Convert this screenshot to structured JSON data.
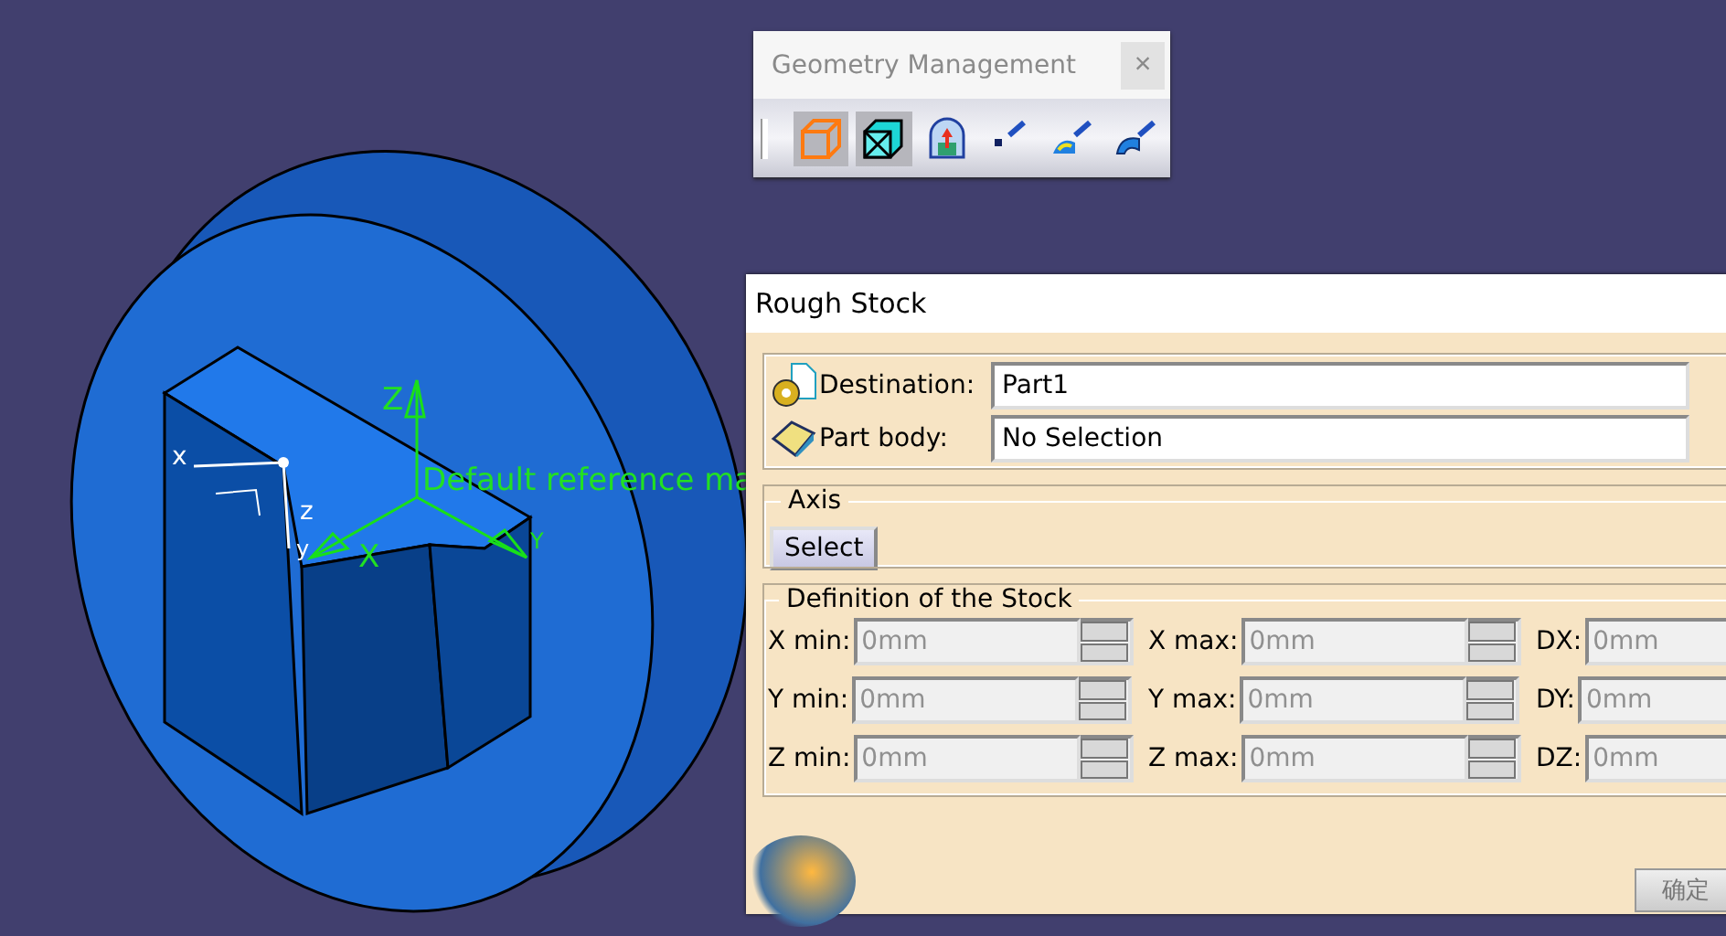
{
  "model_view": {
    "compass_labels": [
      "x",
      "z",
      "y"
    ],
    "axis_labels": [
      "Z",
      "X",
      "Y"
    ],
    "reference_label": "Default reference ma"
  },
  "toolbar": {
    "title": "Geometry Management",
    "close": "×",
    "tools": [
      {
        "kind": "box",
        "selected": true
      },
      {
        "kind": "wire-box",
        "selected": true
      },
      {
        "kind": "part",
        "selected": false
      },
      {
        "kind": "point",
        "selected": false
      },
      {
        "kind": "surface",
        "selected": false
      },
      {
        "kind": "shell",
        "selected": false
      }
    ]
  },
  "dialog": {
    "title": "Rough Stock",
    "destination": {
      "label": "Destination:",
      "value": "Part1"
    },
    "part_body": {
      "label": "Part body:",
      "value": "No Selection"
    },
    "axis": {
      "legend": "Axis",
      "button": "Select"
    },
    "definition": {
      "legend": "Definition of the Stock",
      "fields": [
        {
          "label": "X min:",
          "value": "0mm",
          "kind": "spinner",
          "disabled": true
        },
        {
          "label": "X max:",
          "value": "0mm",
          "kind": "spinner",
          "disabled": true
        },
        {
          "label": "DX:",
          "value": "0mm",
          "kind": "plain",
          "disabled": true
        },
        {
          "label": "Y min:",
          "value": "0mm",
          "kind": "spinner",
          "disabled": true
        },
        {
          "label": "Y max:",
          "value": "0mm",
          "kind": "spinner",
          "disabled": true
        },
        {
          "label": "DY:",
          "value": "0mm",
          "kind": "plain",
          "disabled": true
        },
        {
          "label": "Z min:",
          "value": "0mm",
          "kind": "spinner",
          "disabled": true
        },
        {
          "label": "Z max:",
          "value": "0mm",
          "kind": "spinner",
          "disabled": true
        },
        {
          "label": "DZ:",
          "value": "0mm",
          "kind": "plain",
          "disabled": true
        }
      ]
    },
    "ok_button": "确定"
  }
}
